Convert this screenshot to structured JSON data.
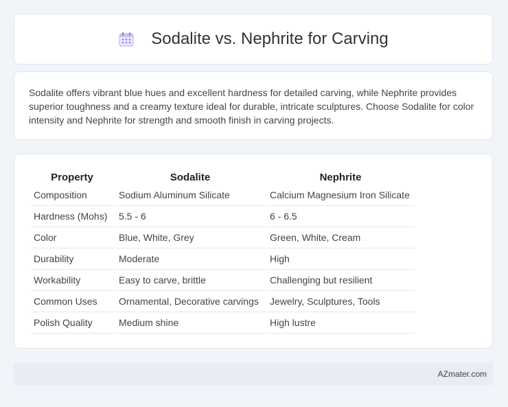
{
  "header": {
    "title": "Sodalite vs. Nephrite for Carving",
    "icon": "calendar-icon",
    "icon_color": "#8b7fe0"
  },
  "summary": {
    "text": "Sodalite offers vibrant blue hues and excellent hardness for detailed carving, while Nephrite provides superior toughness and a creamy texture ideal for durable, intricate sculptures. Choose Sodalite for color intensity and Nephrite for strength and smooth finish in carving projects."
  },
  "table": {
    "headers": [
      "Property",
      "Sodalite",
      "Nephrite"
    ],
    "rows": [
      [
        "Composition",
        "Sodium Aluminum Silicate",
        "Calcium Magnesium Iron Silicate"
      ],
      [
        "Hardness (Mohs)",
        "5.5 - 6",
        "6 - 6.5"
      ],
      [
        "Color",
        "Blue, White, Grey",
        "Green, White, Cream"
      ],
      [
        "Durability",
        "Moderate",
        "High"
      ],
      [
        "Workability",
        "Easy to carve, brittle",
        "Challenging but resilient"
      ],
      [
        "Common Uses",
        "Ornamental, Decorative carvings",
        "Jewelry, Sculptures, Tools"
      ],
      [
        "Polish Quality",
        "Medium shine",
        "High lustre"
      ]
    ]
  },
  "footer": {
    "brand": "AZmater.com"
  },
  "colors": {
    "background": "#f1f4f9",
    "card": "#ffffff",
    "footer_bg": "#e7ecf5"
  }
}
